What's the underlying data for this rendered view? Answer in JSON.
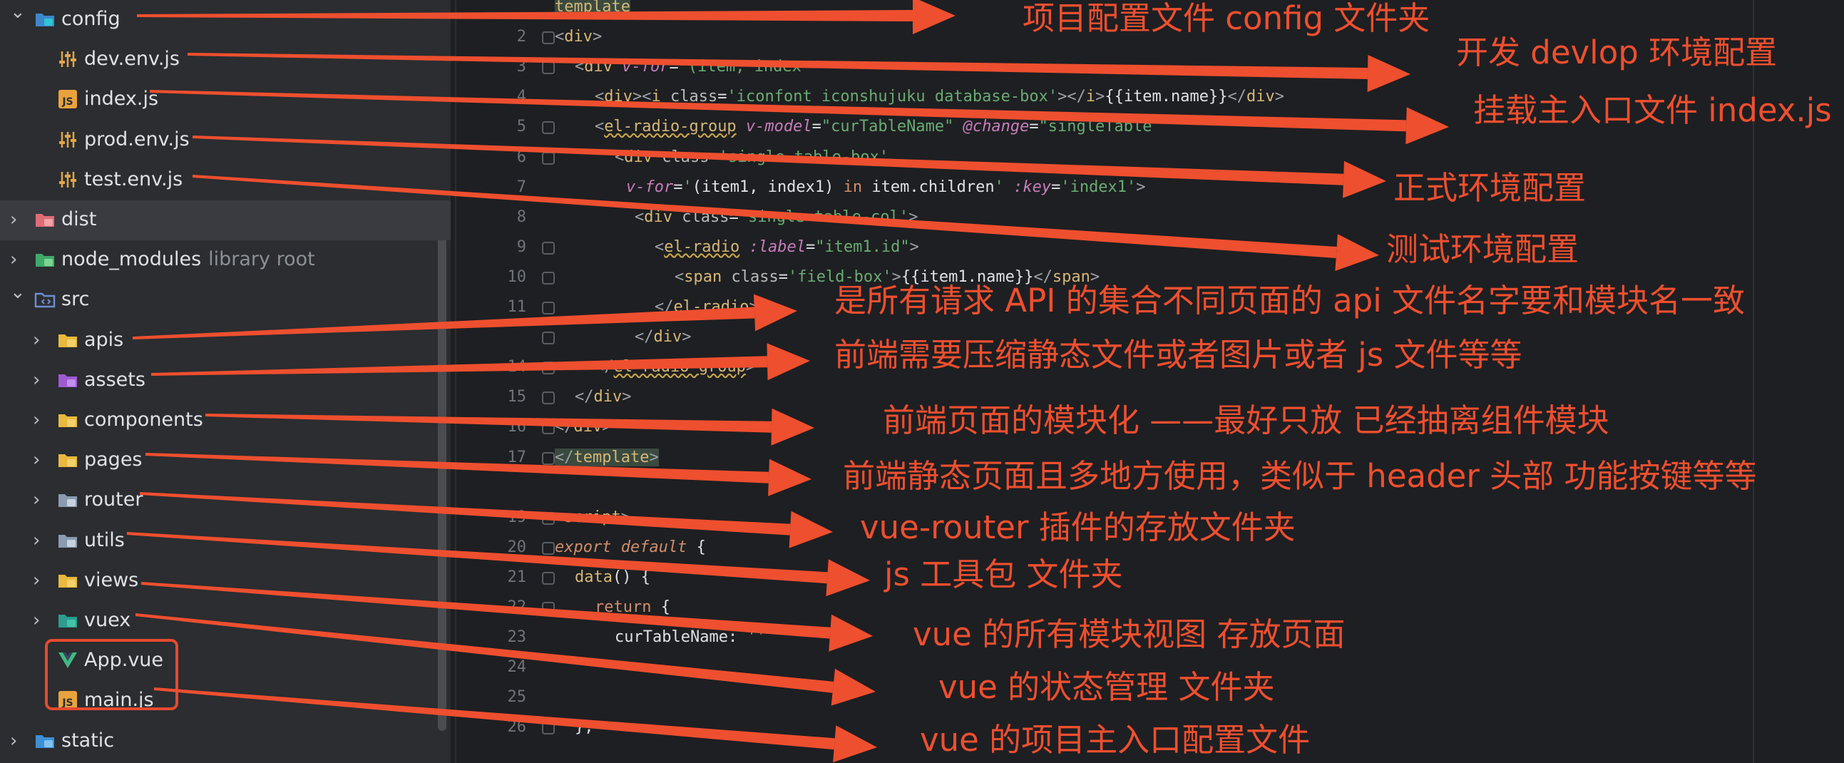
{
  "colors": {
    "annotation": "#ee4f2f",
    "tree_bg": "#2b2d30",
    "editor_bg": "#1e1f22"
  },
  "tree": {
    "items": [
      {
        "label": "config",
        "icon": "gear-folder-icon",
        "expanded": true,
        "level": 0
      },
      {
        "label": "dev.env.js",
        "icon": "env-config-icon",
        "level": 1
      },
      {
        "label": "index.js",
        "icon": "js-file-icon",
        "level": 1
      },
      {
        "label": "prod.env.js",
        "icon": "env-config-icon",
        "level": 1
      },
      {
        "label": "test.env.js",
        "icon": "env-config-icon",
        "level": 1
      },
      {
        "label": "dist",
        "icon": "folder-red-icon",
        "expanded": false,
        "level": 0,
        "selected": true
      },
      {
        "label": "node_modules",
        "suffix": "library root",
        "icon": "folder-green-icon",
        "expanded": false,
        "level": 0
      },
      {
        "label": "src",
        "icon": "source-folder-icon",
        "expanded": true,
        "level": 0
      },
      {
        "label": "apis",
        "icon": "folder-yellow-icon",
        "expanded": false,
        "level": 1
      },
      {
        "label": "assets",
        "icon": "folder-purple-icon",
        "expanded": false,
        "level": 1
      },
      {
        "label": "components",
        "icon": "folder-yellow-icon",
        "expanded": false,
        "level": 1
      },
      {
        "label": "pages",
        "icon": "folder-yellow-icon",
        "expanded": false,
        "level": 1
      },
      {
        "label": "router",
        "icon": "folder-gray-icon",
        "expanded": false,
        "level": 1
      },
      {
        "label": "utils",
        "icon": "folder-gray-icon",
        "expanded": false,
        "level": 1
      },
      {
        "label": "views",
        "icon": "folder-yellow-icon",
        "expanded": false,
        "level": 1
      },
      {
        "label": "vuex",
        "icon": "folder-teal-icon",
        "expanded": false,
        "level": 1
      },
      {
        "label": "App.vue",
        "icon": "vue-file-icon",
        "level": 1
      },
      {
        "label": "main.js",
        "icon": "js-file-icon",
        "level": 1
      },
      {
        "label": "static",
        "icon": "folder-blue-icon",
        "expanded": false,
        "level": 0
      }
    ]
  },
  "editor": {
    "line_numbers": [
      "",
      "2",
      "3",
      "4",
      "5",
      "6",
      "7",
      "8",
      "9",
      "10",
      "11",
      "",
      "14",
      "15",
      "16",
      "17",
      "",
      "19",
      "20",
      "21",
      "22",
      "23",
      "24",
      "25",
      "26"
    ]
  },
  "annotations": [
    "项目配置文件 config 文件夹",
    "开发 devlop 环境配置",
    "挂载主入口文件 index.js",
    "正式环境配置",
    "测试环境配置",
    "是所有请求 API 的集合不同页面的 api 文件名字要和模块名一致",
    "前端需要压缩静态文件或者图片或者 js 文件等等",
    "前端页面的模块化 ——最好只放 已经抽离组件模块",
    "前端静态页面且多地方使用，类似于 header 头部 功能按键等等",
    "vue-router 插件的存放文件夹",
    "js 工具包 文件夹",
    "vue 的所有模块视图 存放页面",
    "vue 的状态管理 文件夹",
    "vue 的项目主入口配置文件"
  ]
}
